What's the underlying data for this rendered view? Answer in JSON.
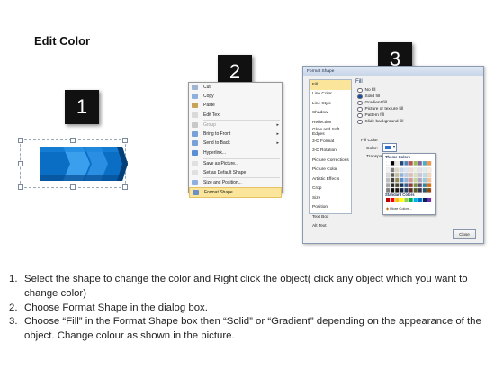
{
  "page": {
    "title": "Edit Color"
  },
  "steps": [
    "1",
    "2",
    "3"
  ],
  "context_menu": {
    "items": [
      {
        "label": "Cut",
        "icon": "scissors-icon",
        "color": "#9fb4d0"
      },
      {
        "label": "Copy",
        "icon": "copy-icon",
        "color": "#8db0dc"
      },
      {
        "label": "Paste",
        "icon": "clipboard-icon",
        "color": "#c9a25a"
      },
      {
        "label": "Edit Text",
        "icon": "edit-text-icon",
        "color": "#d9d9d9"
      },
      {
        "label": "Group",
        "icon": "group-icon",
        "color": "#c8c8c8",
        "submenu": true,
        "disabled": true
      },
      {
        "label": "Bring to Front",
        "icon": "bring-front-icon",
        "color": "#7aa0d8",
        "submenu": true
      },
      {
        "label": "Send to Back",
        "icon": "send-back-icon",
        "color": "#7aa0d8",
        "submenu": true
      },
      {
        "label": "Hyperlink...",
        "icon": "hyperlink-icon",
        "color": "#5a8fd4"
      },
      {
        "label": "Save as Picture...",
        "icon": "picture-icon",
        "color": "#e0e0e0"
      },
      {
        "label": "Set as Default Shape",
        "icon": "default-shape-icon",
        "color": "#e0e0e0"
      },
      {
        "label": "Size and Position...",
        "icon": "size-position-icon",
        "color": "#8fb0de"
      },
      {
        "label": "Format Shape...",
        "icon": "format-shape-icon",
        "color": "#6d8fc8",
        "highlighted": true
      }
    ]
  },
  "dialog": {
    "title": "Format Shape",
    "nav": [
      "Fill",
      "Line Color",
      "Line Style",
      "Shadow",
      "Reflection",
      "Glow and Soft Edges",
      "3-D Format",
      "3-D Rotation",
      "Picture Corrections",
      "Picture Color",
      "Artistic Effects",
      "Crop",
      "Size",
      "Position",
      "Text Box",
      "Alt Text"
    ],
    "selected_nav": "Fill",
    "fill_heading": "Fill",
    "options": [
      {
        "label": "No fill",
        "checked": false
      },
      {
        "label": "Solid fill",
        "checked": true
      },
      {
        "label": "Gradient fill",
        "checked": false
      },
      {
        "label": "Picture or texture fill",
        "checked": false
      },
      {
        "label": "Pattern fill",
        "checked": false
      },
      {
        "label": "Slide background fill",
        "checked": false
      }
    ],
    "fill_color_heading": "Fill Color",
    "color_label": "Color:",
    "transparency_label": "Transparency:",
    "picker": {
      "theme_heading": "Theme Colors",
      "standard_heading": "Standard Colors",
      "more_label": "More Colors...",
      "theme_columns": [
        [
          "#ffffff",
          "#f2f2f2",
          "#d9d9d9",
          "#bfbfbf",
          "#a6a6a6",
          "#808080"
        ],
        [
          "#000000",
          "#7f7f7f",
          "#595959",
          "#404040",
          "#262626",
          "#0d0d0d"
        ],
        [
          "#eeece1",
          "#ddd9c3",
          "#c4bd97",
          "#948a54",
          "#4a452a",
          "#1d1b10"
        ],
        [
          "#1f497d",
          "#c6d9f0",
          "#8db3e2",
          "#548dd4",
          "#17365d",
          "#0f243e"
        ],
        [
          "#4f81bd",
          "#dbe5f1",
          "#b8cce4",
          "#95b3d7",
          "#366092",
          "#244061"
        ],
        [
          "#c0504d",
          "#f2dcdb",
          "#e5b9b7",
          "#d99694",
          "#953734",
          "#632423"
        ],
        [
          "#9bbb59",
          "#ebf1dd",
          "#d7e3bc",
          "#c3d69b",
          "#76923c",
          "#4f6128"
        ],
        [
          "#8064a2",
          "#e5e0ec",
          "#ccc1d9",
          "#b2a2c7",
          "#5f497a",
          "#3f3151"
        ],
        [
          "#4bacc6",
          "#dbeef3",
          "#b7dde8",
          "#92cddc",
          "#31859b",
          "#205867"
        ],
        [
          "#f79646",
          "#fdeada",
          "#fbd5b5",
          "#fac08f",
          "#e36c09",
          "#974806"
        ]
      ],
      "standard_colors": [
        "#c00000",
        "#ff0000",
        "#ffc000",
        "#ffff00",
        "#92d050",
        "#00b050",
        "#00b0f0",
        "#0070c0",
        "#002060",
        "#7030a0"
      ]
    },
    "close_label": "Close"
  },
  "instructions": [
    {
      "num": "1.",
      "text": "Select the shape to change the color and Right click the object( click any object which you want to change color)"
    },
    {
      "num": "2.",
      "text": "Choose Format Shape in the dialog box."
    },
    {
      "num": "3.",
      "text": "Choose “Fill” in the Format Shape box then “Solid” or “Gradient” depending on the appearance of the object. Change colour as shown in the picture."
    }
  ],
  "colors": {
    "shape_blue": "#0a6fc4",
    "shape_light": "#3aa0ee",
    "shape_dark": "#054f96",
    "badge": "#111111",
    "menu_highlight": "#fbe59a"
  }
}
